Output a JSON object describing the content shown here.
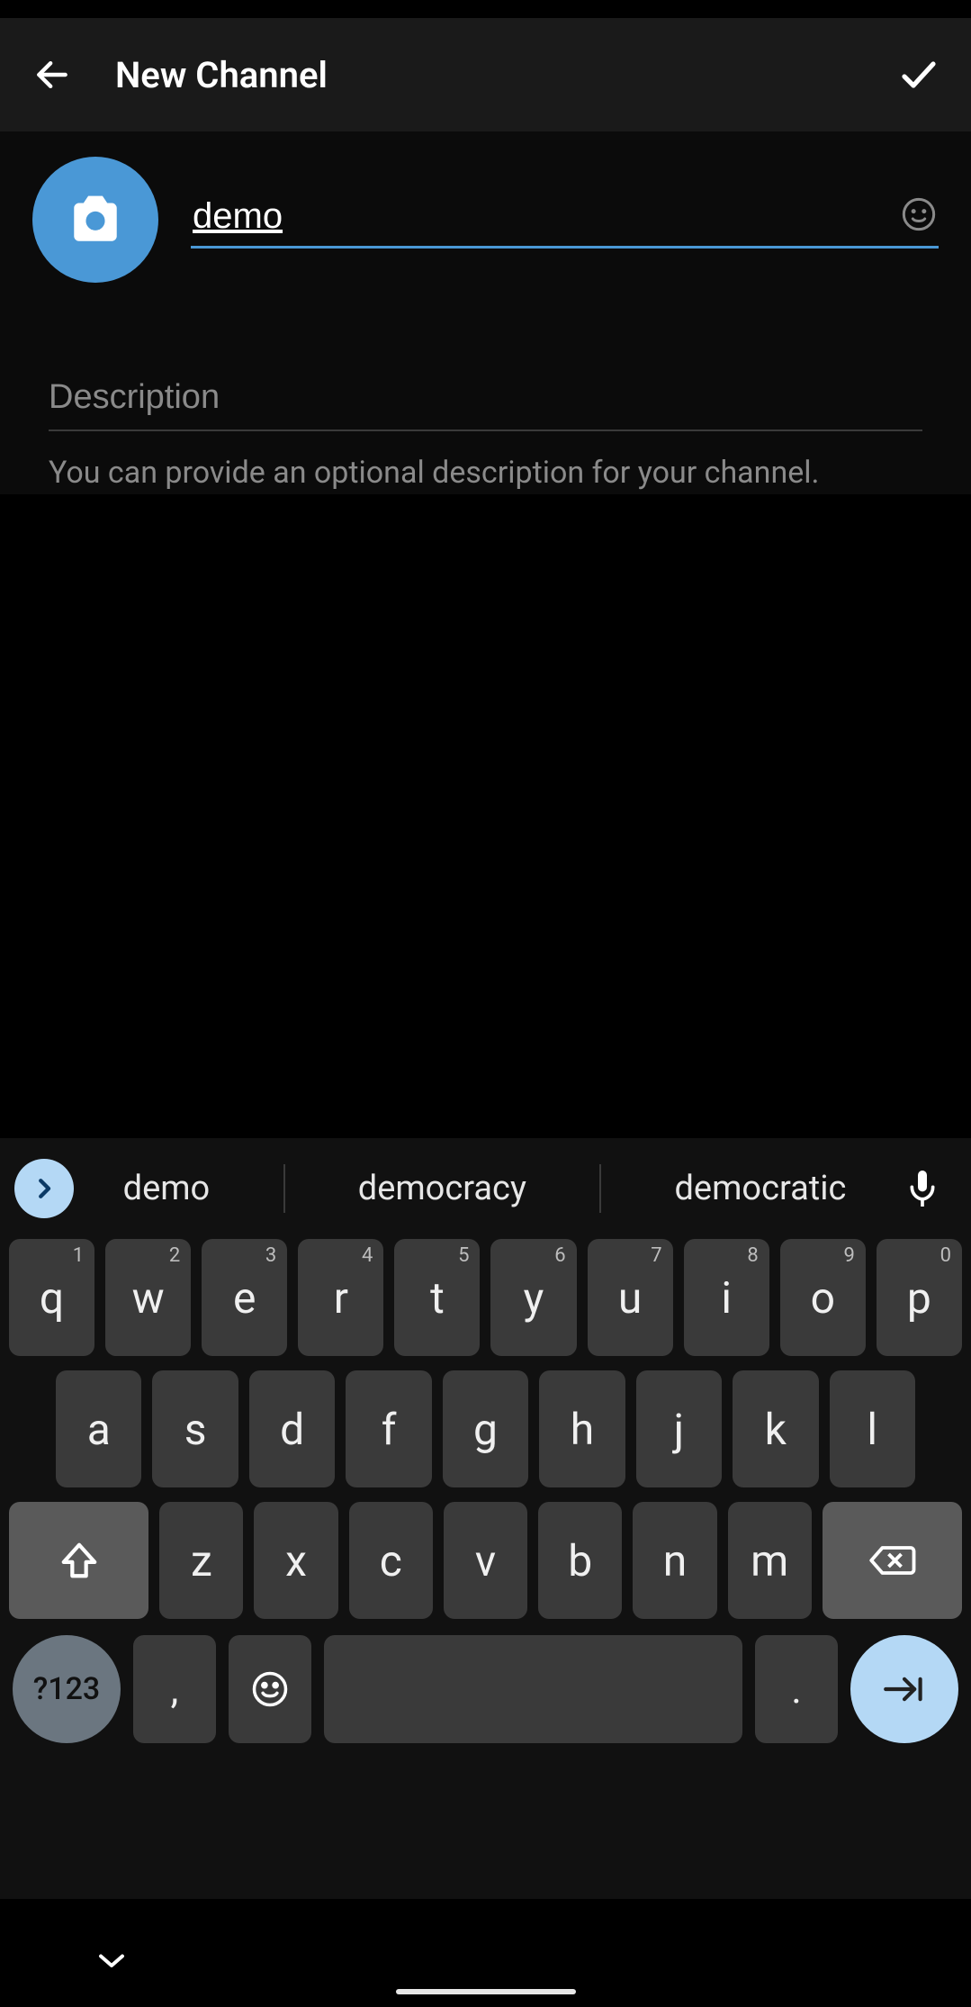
{
  "header": {
    "title": "New Channel"
  },
  "form": {
    "name_value": "demo",
    "description_placeholder": "Description",
    "description_value": "",
    "description_help": "You can provide an optional description for your channel."
  },
  "keyboard": {
    "suggestions": [
      "demo",
      "democracy",
      "democratic"
    ],
    "row1": [
      {
        "k": "q",
        "h": "1"
      },
      {
        "k": "w",
        "h": "2"
      },
      {
        "k": "e",
        "h": "3"
      },
      {
        "k": "r",
        "h": "4"
      },
      {
        "k": "t",
        "h": "5"
      },
      {
        "k": "y",
        "h": "6"
      },
      {
        "k": "u",
        "h": "7"
      },
      {
        "k": "i",
        "h": "8"
      },
      {
        "k": "o",
        "h": "9"
      },
      {
        "k": "p",
        "h": "0"
      }
    ],
    "row2": [
      "a",
      "s",
      "d",
      "f",
      "g",
      "h",
      "j",
      "k",
      "l"
    ],
    "row3": [
      "z",
      "x",
      "c",
      "v",
      "b",
      "n",
      "m"
    ],
    "symbols_label": "?123",
    "comma": ",",
    "period": "."
  }
}
